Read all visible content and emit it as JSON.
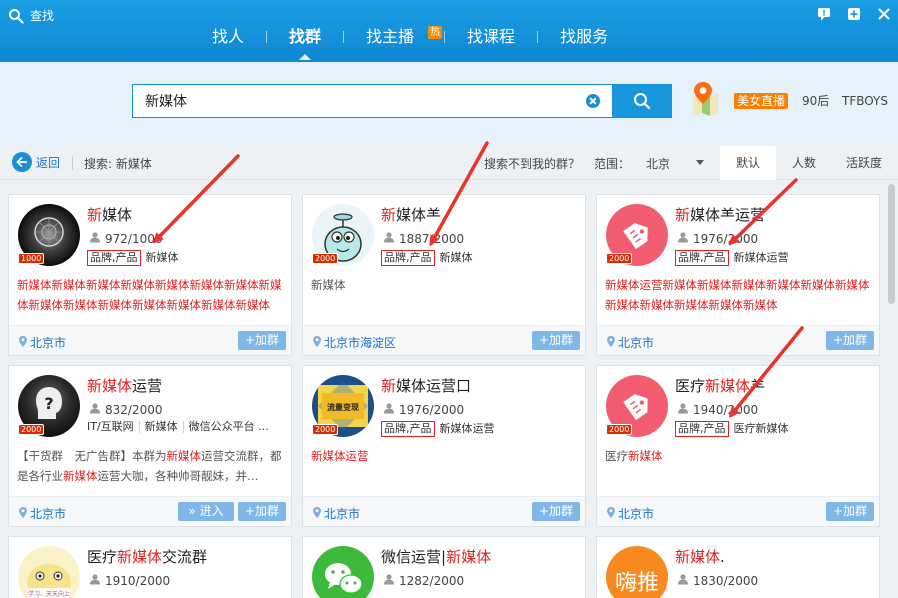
{
  "app": {
    "title": "查找"
  },
  "nav": {
    "items": [
      {
        "label": "找人"
      },
      {
        "label": "找群"
      },
      {
        "label": "找主播",
        "badge": "热"
      },
      {
        "label": "找课程"
      },
      {
        "label": "找服务"
      }
    ]
  },
  "search": {
    "value": "新媒体"
  },
  "hot": {
    "tag": "美女直播",
    "links": [
      "90后",
      "TFBOYS"
    ]
  },
  "filter": {
    "back": "返回",
    "search_prefix": "搜索:",
    "keyword": "新媒体",
    "not_found": "搜索不到我的群？",
    "range_label": "范围：",
    "range_value": "北京",
    "sorts": [
      "默认",
      "人数",
      "活跃度"
    ]
  },
  "cards": [
    {
      "name_hl": "新",
      "name_rest": "媒体",
      "level": "1000",
      "members": "972/1000",
      "tags": [
        "品牌,产品",
        "新媒体"
      ],
      "desc": "新媒体新媒体新媒体新媒体新媒体新媒体新媒体新媒体新媒体新媒体新媒体新媒体新媒体新媒体新媒体新…",
      "desc_style": "red",
      "location": "北京市",
      "join": "+加群"
    },
    {
      "name_hl": "新",
      "name_rest": "媒体⺷",
      "level": "2000",
      "members": "1887/2000",
      "tags": [
        "品牌,产品",
        "新媒体"
      ],
      "desc": "新媒体",
      "desc_style": "gray",
      "location": "北京市海淀区",
      "join": "+加群"
    },
    {
      "name_hl": "新",
      "name_rest": "媒体⺷运营",
      "level": "2000",
      "members": "1976/2000",
      "tags": [
        "品牌,产品",
        "新媒体运营"
      ],
      "desc": "新媒体运营新媒体新媒体新媒体新媒体新媒体新媒体新媒体新媒体新媒体新媒体新媒体",
      "desc_style": "red",
      "location": "北京市",
      "join": "+加群"
    },
    {
      "name_hl": "新媒体",
      "name_rest": "运营",
      "level": "2000",
      "members": "832/2000",
      "tags": [
        "IT/互联网",
        "新媒体",
        "微信公众平台 ..."
      ],
      "desc_parts": [
        "【干货群　无广告群】本群为",
        "新媒体",
        "运营交流群，都是各行业",
        "新媒体",
        "运营大咖，各种帅哥靓妹，并…"
      ],
      "desc_style": "mixed",
      "location": "北京市",
      "enter": "» 进入",
      "join": "+加群"
    },
    {
      "name_hl": "新",
      "name_rest": "媒体运营⼝",
      "level": "2000",
      "members": "1976/2000",
      "tags": [
        "品牌,产品",
        "新媒体运营"
      ],
      "desc": "新媒体运营",
      "desc_style": "red",
      "location": "北京市",
      "join": "+加群",
      "avatar_text": "流量变现"
    },
    {
      "name_pre": "医疗",
      "name_hl": "新媒体",
      "name_rest": "⺷",
      "level": "2000",
      "members": "1940/2000",
      "tags": [
        "品牌,产品",
        "医疗新媒体"
      ],
      "desc_parts": [
        "医疗",
        "新媒体"
      ],
      "desc_style": "mixed",
      "location": "北京市",
      "join": "+加群"
    },
    {
      "name_pre": "医疗",
      "name_hl": "新媒体",
      "name_rest": "交流群",
      "members": "1910/2000",
      "avatar_text": "学习、天天向上"
    },
    {
      "name_pre": "微信运营|",
      "name_hl": "新媒体",
      "name_rest": "",
      "members": "1282/2000"
    },
    {
      "name_hl": "新媒体",
      "name_rest": ".",
      "members": "1830/2000",
      "avatar_text": "嗨推"
    }
  ],
  "colors": {
    "brand": "#1a9ee5",
    "highlight": "#e02020",
    "hot": "#ff7e00"
  }
}
